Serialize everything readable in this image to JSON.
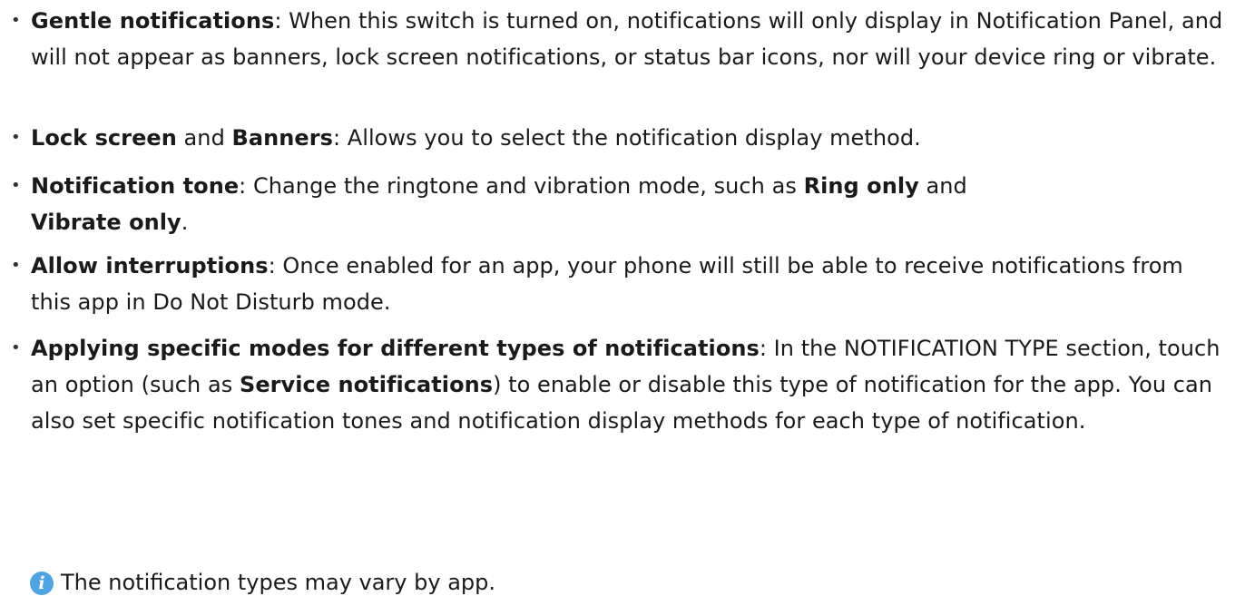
{
  "bullets": [
    {
      "term": "Gentle notifications",
      "text": ": When this switch is turned on, notifications will only display in Notification Panel, and will not appear as banners, lock screen notifications, or status bar icons, nor will your device ring or vibrate."
    },
    {
      "term": "Lock screen",
      "mid": " and ",
      "term2": "Banners",
      "text": ": Allows you to select the notification display method."
    },
    {
      "term": "Notification tone",
      "text": ": Change the ringtone and vibration mode, such as ",
      "term2": "Ring only",
      "mid": " and ",
      "term3": "Vibrate only",
      "end": "."
    },
    {
      "term": "Allow interruptions",
      "text": ": Once enabled for an app, your phone will still be able to receive notifications from this app in Do Not Disturb mode."
    },
    {
      "term": "Applying specific modes for different types of notifications",
      "text": ": In the NOTIFICATION TYPE section, touch an option (such as ",
      "term2": "Service notifications",
      "text2": ") to enable or disable this type of notification for the app. You can also set specific notification tones and notification display methods for each type of notification."
    }
  ],
  "bullet_symbol": "•",
  "note": {
    "icon": "info-icon",
    "icon_glyph": "i",
    "icon_color": "#4fa3e0",
    "text": "The notification types may vary by app."
  }
}
